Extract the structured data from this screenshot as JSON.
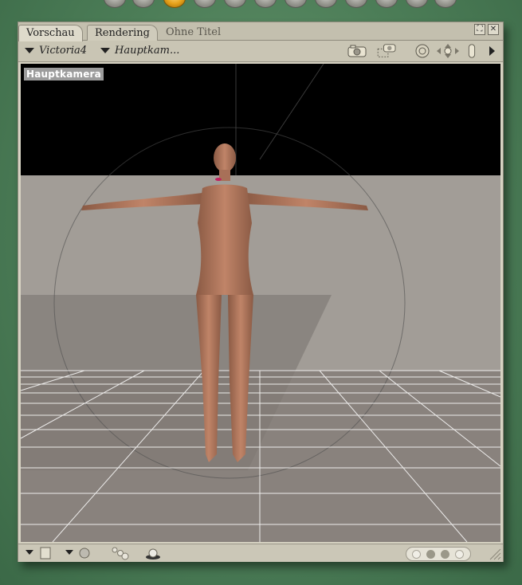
{
  "window": {
    "tabs": [
      {
        "label": "Vorschau",
        "active": true
      },
      {
        "label": "Rendering",
        "active": false
      },
      {
        "label": "Ohne Titel",
        "active": false
      }
    ]
  },
  "menubar": {
    "figure_select": "Victoria4",
    "camera_select": "Hauptkam..."
  },
  "viewport": {
    "camera_label": "Hauptkamera",
    "background_top": "#000000",
    "floor_color": "#a29d97",
    "grid_color": "#ffffff"
  },
  "toolbar_icons": [
    "camera-icon",
    "camera-select-icon",
    "trackball-icon",
    "move-xy-icon",
    "move-z-icon",
    "arrow-right-icon"
  ],
  "bottombar_icons": [
    "document-icon",
    "sphere-icon",
    "bubbles-icon",
    "light-icon"
  ],
  "colors": {
    "window_bg": "#d7d3c3",
    "accent_dial": "#e7a21a",
    "desktop": "#4c7d57"
  }
}
